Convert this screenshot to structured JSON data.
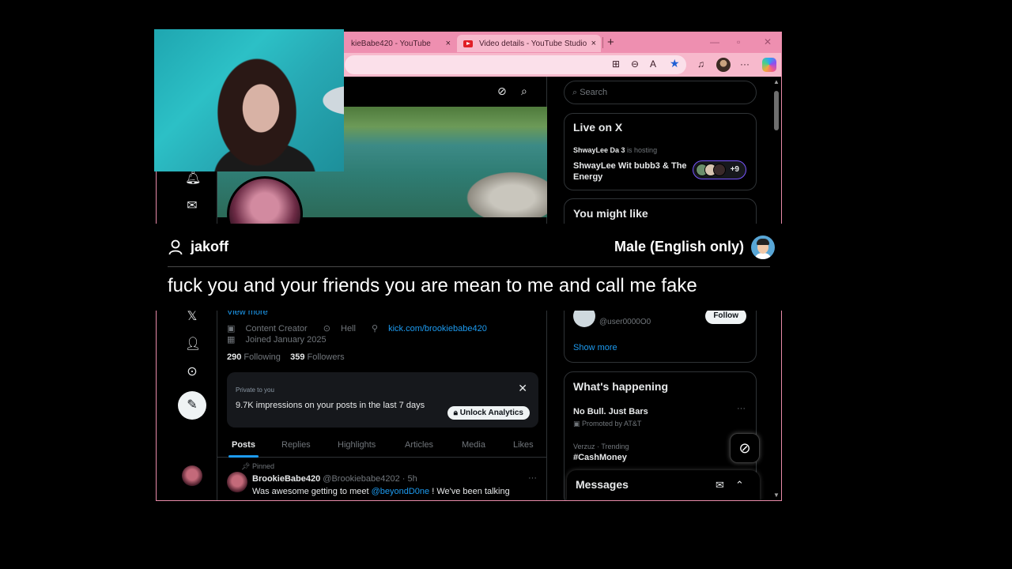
{
  "browser": {
    "tabs": [
      {
        "label": "kieBabe420 - YouTube",
        "close": "×"
      },
      {
        "label": "Video details - YouTube Studio",
        "close": "×"
      }
    ],
    "new_tab": "+"
  },
  "nav": {
    "icons": [
      "bell-icon",
      "mail-icon",
      "x-logo-icon",
      "person-icon",
      "more-icon",
      "compose-icon"
    ]
  },
  "profile": {
    "view_more": "View more",
    "category": "Content Creator",
    "location": "Hell",
    "link": "kick.com/brookiebabe420",
    "joined": "Joined January 2025",
    "following_count": "290",
    "following_label": "Following",
    "followers_count": "359",
    "followers_label": "Followers"
  },
  "promo": {
    "small": "Private to you",
    "main": "9.7K impressions on your posts in the last 7 days",
    "button": "Unlock Analytics"
  },
  "profile_tabs": [
    "Posts",
    "Replies",
    "Highlights",
    "Articles",
    "Media",
    "Likes"
  ],
  "post": {
    "pinned": "Pinned",
    "name": "BrookieBabe420",
    "handle": "@Brookiebabe4202 · 5h",
    "text_start": "Was awesome getting to meet ",
    "mention": "@beyondD0ne",
    "text_end": " ! We've been talking"
  },
  "sidebar": {
    "search_placeholder": "Search",
    "live": {
      "title": "Live on X",
      "host_name": "ShwayLee Da 3",
      "host_suffix": "is hosting",
      "space_title_1": "ShwayLee Wit bubb3 & The",
      "space_title_2": "Energy",
      "plus": "+9"
    },
    "you_might_like": {
      "title": "You might like",
      "handle": "@user0000O0",
      "follow": "Follow",
      "show_more": "Show more"
    },
    "happening": {
      "title": "What's happening",
      "item1_title": "No Bull. Just Bars",
      "item1_sub": "Promoted by AT&T",
      "item2_context": "Verzuz · Trending",
      "item2_title": "#CashMoney"
    },
    "messages": "Messages"
  },
  "chat": {
    "username": "jakoff",
    "filter": "Male (English only)",
    "message": "fuck you and your friends you are mean to me and call me fake"
  },
  "colors": {
    "accent": "#1d9bf0",
    "browser_chrome": "#f29ab8",
    "background": "#000000"
  }
}
